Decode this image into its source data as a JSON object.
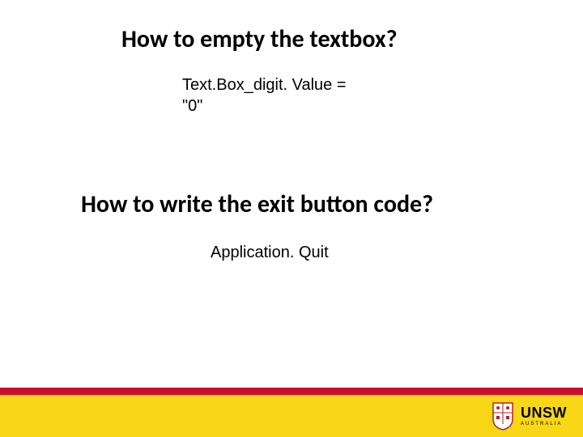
{
  "slide": {
    "heading1": "How to empty the textbox?",
    "code1_line1": "Text.Box_digit. Value =",
    "code1_line2": "\"0\"",
    "heading2": "How to write the exit button code?",
    "code2": "Application. Quit"
  },
  "footer": {
    "logo_main": "UNSW",
    "logo_sub": "AUSTRALIA"
  }
}
